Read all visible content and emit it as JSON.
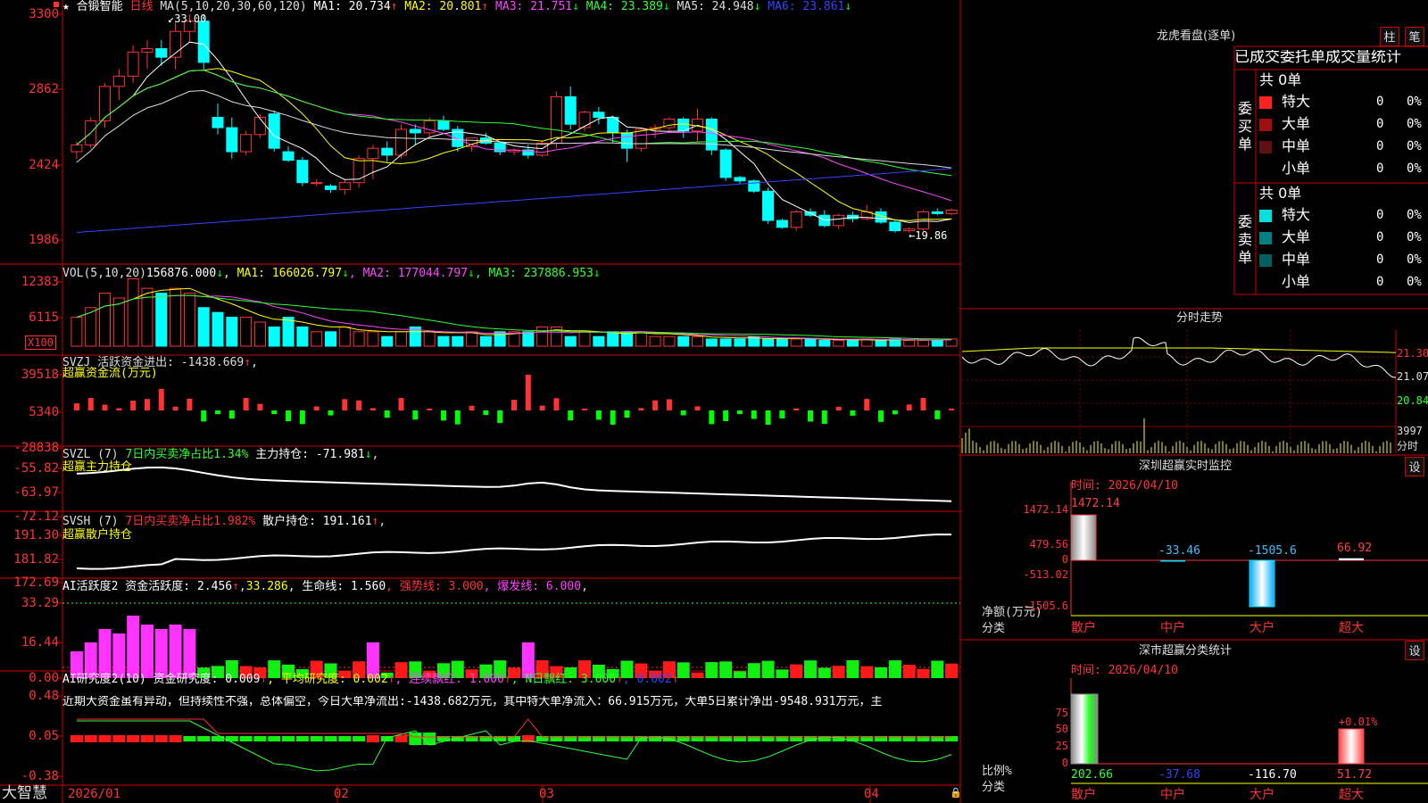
{
  "stock": {
    "name": "合锻智能",
    "period": "日线",
    "ma_param": "MA(5,10,20,30,60,120)",
    "ma_values": [
      {
        "label": "MA1: 20.734",
        "arrow": "↑",
        "color": "#ffffff",
        "arrow_color": "#ff3333"
      },
      {
        "label": "MA2: 20.801",
        "arrow": "↑",
        "color": "#ffff00",
        "arrow_color": "#ff3333"
      },
      {
        "label": "MA3: 21.751",
        "arrow": "↓",
        "color": "#ff44ff",
        "arrow_color": "#00ff00"
      },
      {
        "label": "MA4: 23.389",
        "arrow": "↓",
        "color": "#33ff33",
        "arrow_color": "#00ff00"
      },
      {
        "label": "MA5: 24.948",
        "arrow": "↓",
        "color": "#dddddd",
        "arrow_color": "#00ff00"
      },
      {
        "label": "MA6: 23.861",
        "arrow": "↓",
        "color": "#3344ff",
        "arrow_color": "#00ff00"
      }
    ],
    "high_label": "33.00",
    "low_label": "←19.86",
    "y_ticks": [
      "3300",
      "2862",
      "2424",
      "1986"
    ]
  },
  "vol": {
    "header": [
      {
        "t": "VOL(5,10,20)",
        "c": "#dddddd"
      },
      {
        "t": "156876.000",
        "c": "#ffffff"
      },
      {
        "t": "↓",
        "c": "#00ff00"
      },
      {
        "t": ", MA1: 166026.797",
        "c": "#ffff00"
      },
      {
        "t": "↓",
        "c": "#00ff00"
      },
      {
        "t": ", MA2: 177044.797",
        "c": "#ff44ff"
      },
      {
        "t": "↓",
        "c": "#00ff00"
      },
      {
        "t": ", MA3: 237886.953",
        "c": "#33ff33"
      },
      {
        "t": "↓",
        "c": "#00ff00"
      }
    ],
    "y_ticks": [
      "12383",
      "6115"
    ],
    "unit": "X100",
    "values": [
      6,
      8,
      11,
      10,
      14,
      12,
      11,
      12,
      11,
      8,
      7,
      6,
      6,
      5,
      4,
      6,
      4,
      3,
      3,
      4,
      3,
      3,
      2,
      3,
      4,
      3,
      2,
      2,
      3,
      2,
      3,
      3,
      3,
      4,
      4,
      2,
      3,
      2,
      3,
      3,
      3,
      2,
      2,
      2,
      2,
      1.5,
      1.5,
      1.5,
      2,
      1.5,
      1.5,
      1.5,
      1.5,
      1.2,
      1.2,
      1.2,
      1.5,
      1.2,
      1.5,
      1.2,
      1.2,
      1.2,
      1.5
    ]
  },
  "svzj": {
    "header": [
      {
        "t": "SVZJ 活跃资金进出: -1438.669",
        "c": "#dddddd"
      },
      {
        "t": "↑",
        "c": "#ff3333"
      },
      {
        "t": ",",
        "c": "#dddddd"
      }
    ],
    "sub": "超赢资金流(万元)",
    "y_ticks": [
      "39518",
      "5340",
      "-28838"
    ]
  },
  "svzl": {
    "header": [
      {
        "t": "SVZL (7) ",
        "c": "#dddddd"
      },
      {
        "t": "7日内买卖净占比1.34%",
        "c": "#33ff33"
      },
      {
        "t": " 主力持仓: -71.981",
        "c": "#ffffff"
      },
      {
        "t": "↓",
        "c": "#00ff00"
      },
      {
        "t": ",",
        "c": "#dddddd"
      }
    ],
    "sub": "超赢主力持仓",
    "y_ticks": [
      "-55.82",
      "-63.97",
      "-72.12"
    ]
  },
  "svsh": {
    "header": [
      {
        "t": "SVSH (7) ",
        "c": "#dddddd"
      },
      {
        "t": "7日内买卖净占比1.982%",
        "c": "#ff3333"
      },
      {
        "t": " 散户持仓: 191.161",
        "c": "#ffffff"
      },
      {
        "t": "↑",
        "c": "#ff3333"
      },
      {
        "t": ",",
        "c": "#dddddd"
      }
    ],
    "sub": "超赢散户持仓",
    "y_ticks": [
      "191.30",
      "181.82",
      "172.69"
    ]
  },
  "ai1": {
    "header": [
      {
        "t": "AI活跃度2 资金活跃度: 2.456",
        "c": "#ffffff"
      },
      {
        "t": "↑",
        "c": "#ff3333"
      },
      {
        "t": ",",
        "c": "#dddddd"
      },
      {
        "t": "33.286",
        "c": "#ffff00"
      },
      {
        "t": ", 生命线: 1.560",
        "c": "#ffffff"
      },
      {
        "t": ", 强势线: 3.000",
        "c": "#ff3333"
      },
      {
        "t": ", 爆发线: 6.000",
        "c": "#ff44ff"
      },
      {
        "t": ",",
        "c": "#dddddd"
      }
    ],
    "y_ticks": [
      "33.29",
      "16.44",
      "0.00"
    ]
  },
  "ai2": {
    "header": [
      {
        "t": "AI研究度2(10) 资金研究度: 0.009",
        "c": "#ffffff"
      },
      {
        "t": "↑",
        "c": "#ff3333"
      },
      {
        "t": ", 平均研究度: 0.002",
        "c": "#ffff00"
      },
      {
        "t": "↑",
        "c": "#ff3333"
      },
      {
        "t": ", 连续飘红: 1.000",
        "c": "#ff44ff"
      },
      {
        "t": "↑",
        "c": "#ff3333"
      },
      {
        "t": ", N日飘红: 3.000",
        "c": "#33ff33"
      },
      {
        "t": "↑",
        "c": "#ff3333"
      },
      {
        "t": ", 0.002",
        "c": "#3344ff"
      },
      {
        "t": "↑",
        "c": "#ff3333"
      }
    ],
    "comment": "近期大资金虽有异动，但持续性不强，总体偏空，今日大单净流出:-1438.682万元，其中特大单净流入：66.915万元，大单5日累计净出-9548.931万元，主",
    "y_ticks": [
      "0.48",
      "0.05",
      "-0.38"
    ]
  },
  "x_axis": {
    "labels": [
      "2026/01",
      "02",
      "03",
      "04"
    ]
  },
  "logo": "大智慧",
  "right": {
    "title": "龙虎看盘(逐单)",
    "btn_zhu": "柱",
    "btn_bi": "笔",
    "stat_title": "已成交委托单成交量统计",
    "buy": {
      "side": "委\n买\n单",
      "total": "共 0单",
      "rows": [
        {
          "label": "特大",
          "val": "0",
          "pct": "0%",
          "color": "#ff2020"
        },
        {
          "label": "大单",
          "val": "0",
          "pct": "0%",
          "color": "#a01010"
        },
        {
          "label": "中单",
          "val": "0",
          "pct": "0%",
          "color": "#601010"
        },
        {
          "label": "小单",
          "val": "0",
          "pct": "0%",
          "color": "#000000"
        }
      ]
    },
    "sell": {
      "side": "委\n卖\n单",
      "total": "共 0单",
      "rows": [
        {
          "label": "特大",
          "val": "0",
          "pct": "0%",
          "color": "#00e0e0"
        },
        {
          "label": "大单",
          "val": "0",
          "pct": "0%",
          "color": "#008080"
        },
        {
          "label": "中单",
          "val": "0",
          "pct": "0%",
          "color": "#006060"
        },
        {
          "label": "小单",
          "val": "0",
          "pct": "0%",
          "color": "#000000"
        }
      ]
    },
    "fenshi": {
      "title": "分时走势",
      "y_ticks": [
        "21.30",
        "21.07",
        "20.84"
      ],
      "vol_tick": "3997",
      "vol_unit": "分时"
    },
    "monitor": {
      "title": "深圳超赢实时监控",
      "settings": "设",
      "time": "时间: 2026/04/10",
      "y_ticks": [
        "1472.14",
        "479.56",
        "0",
        "-513.02",
        "-1505.6"
      ],
      "y_unit": "净额(万元)",
      "cat_label": "分类",
      "categories": [
        "散户",
        "中户",
        "大户",
        "超大"
      ],
      "values": [
        "1472.14",
        "-33.46",
        "-1505.6",
        "66.92"
      ],
      "value_colors": [
        "#ff4040",
        "#40c0ff",
        "#40c0ff",
        "#ff4040"
      ]
    },
    "classify": {
      "title": "深市超赢分类统计",
      "settings": "设",
      "time": "时间: 2026/04/10",
      "y_ticks": [
        "75",
        "50",
        "25",
        "0"
      ],
      "y_unit": "比例%",
      "cat_label": "分类",
      "categories": [
        "散户",
        "中户",
        "大户",
        "超大"
      ],
      "values": [
        "202.66",
        "-37.68",
        "-116.70",
        "51.72"
      ],
      "value_colors": [
        "#33ff33",
        "#3344ff",
        "#ffffff",
        "#ff4040"
      ],
      "top_label": "+0.01%"
    }
  },
  "chart_data": {
    "type": "candlestick",
    "title": "合锻智能 日线",
    "x_labels": [
      "2026/01",
      "02",
      "03",
      "04"
    ],
    "ylim": [
      19.86,
      33.0
    ],
    "y_ticks": [
      33.0,
      28.62,
      24.24,
      19.86
    ],
    "series": [
      {
        "name": "price",
        "ohlc": [
          [
            25,
            25.6,
            24.6,
            25.4
          ],
          [
            25.4,
            27,
            25.2,
            26.8
          ],
          [
            26.8,
            29,
            26.4,
            28.8
          ],
          [
            28.8,
            29.8,
            28,
            29.4
          ],
          [
            29.4,
            31.2,
            29,
            30.8
          ],
          [
            30.8,
            31.5,
            29.8,
            31
          ],
          [
            31,
            31.5,
            30,
            30.5
          ],
          [
            30.5,
            32.5,
            29.8,
            32
          ],
          [
            32,
            33,
            31.4,
            32.6
          ],
          [
            32.6,
            33,
            29.8,
            30.2
          ],
          [
            27,
            27.8,
            26,
            26.4
          ],
          [
            26.4,
            27,
            24.6,
            25
          ],
          [
            25,
            26.2,
            24.8,
            26
          ],
          [
            26,
            27.2,
            25.8,
            27
          ],
          [
            27.2,
            27.4,
            25,
            25.2
          ],
          [
            25,
            25.3,
            24.4,
            24.5
          ],
          [
            24.5,
            24.7,
            23,
            23.2
          ],
          [
            23.2,
            23.4,
            23,
            23.2
          ],
          [
            23,
            23.1,
            22.6,
            22.8
          ],
          [
            22.8,
            23.4,
            22.5,
            23.2
          ],
          [
            23.2,
            24.8,
            22.9,
            24.6
          ],
          [
            24.6,
            25.4,
            23.4,
            25.2
          ],
          [
            25.2,
            25.6,
            24.4,
            24.8
          ],
          [
            24.8,
            26.6,
            24.6,
            26.3
          ],
          [
            26.3,
            26.6,
            25.4,
            26.1
          ],
          [
            26.1,
            27,
            25.9,
            26.8
          ],
          [
            26.8,
            27.1,
            26.2,
            26.3
          ],
          [
            26.3,
            26.5,
            25,
            25.3
          ],
          [
            25.3,
            25.8,
            25,
            25.8
          ],
          [
            25.8,
            26.1,
            25.4,
            25.5
          ],
          [
            25.5,
            25.6,
            24.8,
            25
          ],
          [
            25,
            25.2,
            24.8,
            25.1
          ],
          [
            25.1,
            25.4,
            24.6,
            24.8
          ],
          [
            24.8,
            25.6,
            24.7,
            25.5
          ],
          [
            25.5,
            28.5,
            25.2,
            28.2
          ],
          [
            28.2,
            28.8,
            26.3,
            26.6
          ],
          [
            26.4,
            27.4,
            26.2,
            27.3
          ],
          [
            27.3,
            27.6,
            26.6,
            27
          ],
          [
            27,
            27.1,
            25.5,
            26.1
          ],
          [
            26.1,
            26.3,
            24.4,
            25.2
          ],
          [
            25.2,
            26.4,
            25,
            26.3
          ],
          [
            26.3,
            26.6,
            25.8,
            26.4
          ],
          [
            26.4,
            27,
            26.2,
            26.9
          ],
          [
            26.9,
            27,
            25.8,
            26.2
          ],
          [
            26.2,
            27.5,
            25.6,
            26.9
          ],
          [
            26.9,
            27,
            24.8,
            25.1
          ],
          [
            25.1,
            25.2,
            23.3,
            23.5
          ],
          [
            23.5,
            23.6,
            23.1,
            23.3
          ],
          [
            23.3,
            23.4,
            22.6,
            22.7
          ],
          [
            22.7,
            22.9,
            20.8,
            21
          ],
          [
            21,
            21.1,
            20.5,
            20.6
          ],
          [
            20.6,
            21.6,
            20.4,
            21.5
          ],
          [
            21.5,
            21.7,
            21.2,
            21.3
          ],
          [
            21.3,
            21.6,
            20.6,
            20.7
          ],
          [
            20.7,
            21.4,
            20.5,
            21.3
          ],
          [
            21.3,
            21.5,
            20.9,
            21.1
          ],
          [
            21.1,
            21.9,
            21,
            21.5
          ],
          [
            21.5,
            21.7,
            20.8,
            20.9
          ],
          [
            20.9,
            21,
            20.3,
            20.4
          ],
          [
            20.4,
            20.6,
            20.3,
            20.5
          ],
          [
            20.5,
            21.6,
            20.4,
            21.5
          ],
          [
            21.5,
            21.7,
            21.3,
            21.4
          ],
          [
            21.4,
            21.7,
            21.3,
            21.6
          ]
        ]
      }
    ]
  }
}
